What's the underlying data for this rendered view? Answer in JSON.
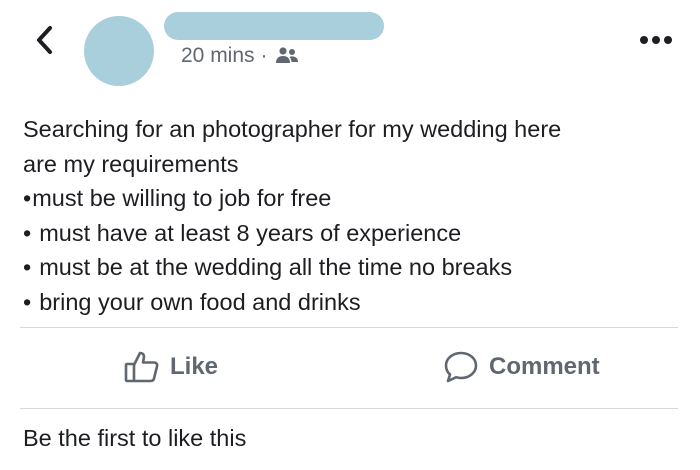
{
  "header": {
    "back_icon": "chevron-left-icon",
    "timestamp": "20 mins",
    "separator": "·",
    "audience_icon": "friends-icon",
    "more_icon": "more-horizontal-icon",
    "placeholder_color": "#a9cfdc"
  },
  "post": {
    "lines": [
      "Searching for an photographer for my wedding here",
      "are my requirements"
    ],
    "bullets": [
      "must be willing to job for free",
      "must have at least 8 years of experience",
      "must be at the wedding all the time no breaks",
      "bring your own food and drinks"
    ],
    "bullet_char": "•"
  },
  "actions": {
    "like_label": "Like",
    "like_icon": "thumbs-up-icon",
    "comment_label": "Comment",
    "comment_icon": "comment-icon"
  },
  "footer": {
    "likes_summary": "Be the first to like this"
  },
  "colors": {
    "text": "#1c1e21",
    "secondary_text": "#616770",
    "action_text": "#606770",
    "divider": "#d5d8dc"
  }
}
